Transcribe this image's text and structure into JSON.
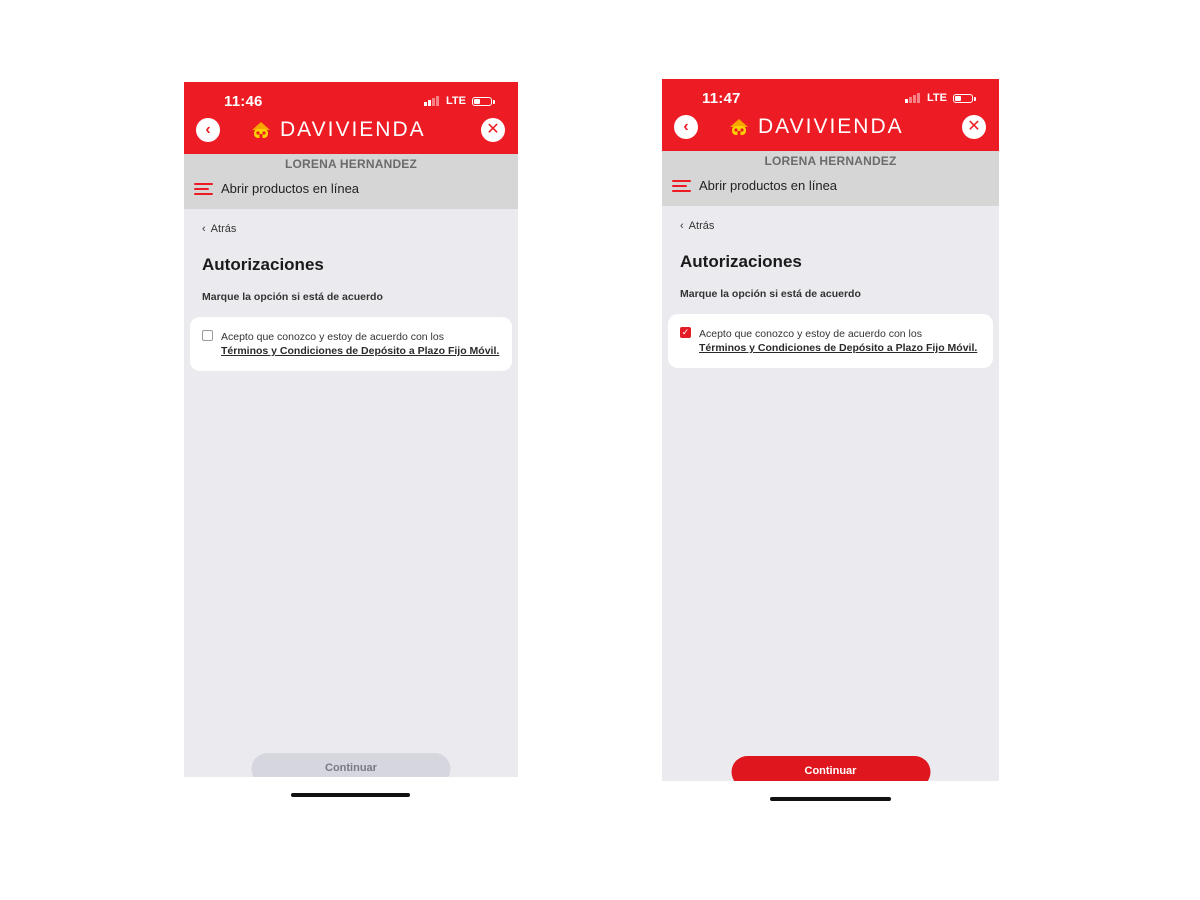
{
  "brand": {
    "primary_color": "#ed1c24",
    "logo_text": "DAVIVIENDA",
    "logo_icon": "davivienda-house-icon"
  },
  "common": {
    "user_name": "LORENA HERNANDEZ",
    "menu_label": "Abrir productos en línea",
    "back_label": "Atrás",
    "page_title": "Autorizaciones",
    "instruction": "Marque la opción si está de acuerdo",
    "terms_prefix": "Acepto que conozco y estoy de acuerdo con los",
    "terms_link": "Términos y Condiciones de Depósito a Plazo Fijo Móvil.",
    "continue_label": "Continuar",
    "network_label": "LTE",
    "nav_back_icon": "chevron-left-icon",
    "nav_close_icon": "close-icon"
  },
  "screens": [
    {
      "status_time": "11:46",
      "checkbox_checked": false,
      "continue_enabled": false
    },
    {
      "status_time": "11:47",
      "checkbox_checked": true,
      "continue_enabled": true
    }
  ]
}
